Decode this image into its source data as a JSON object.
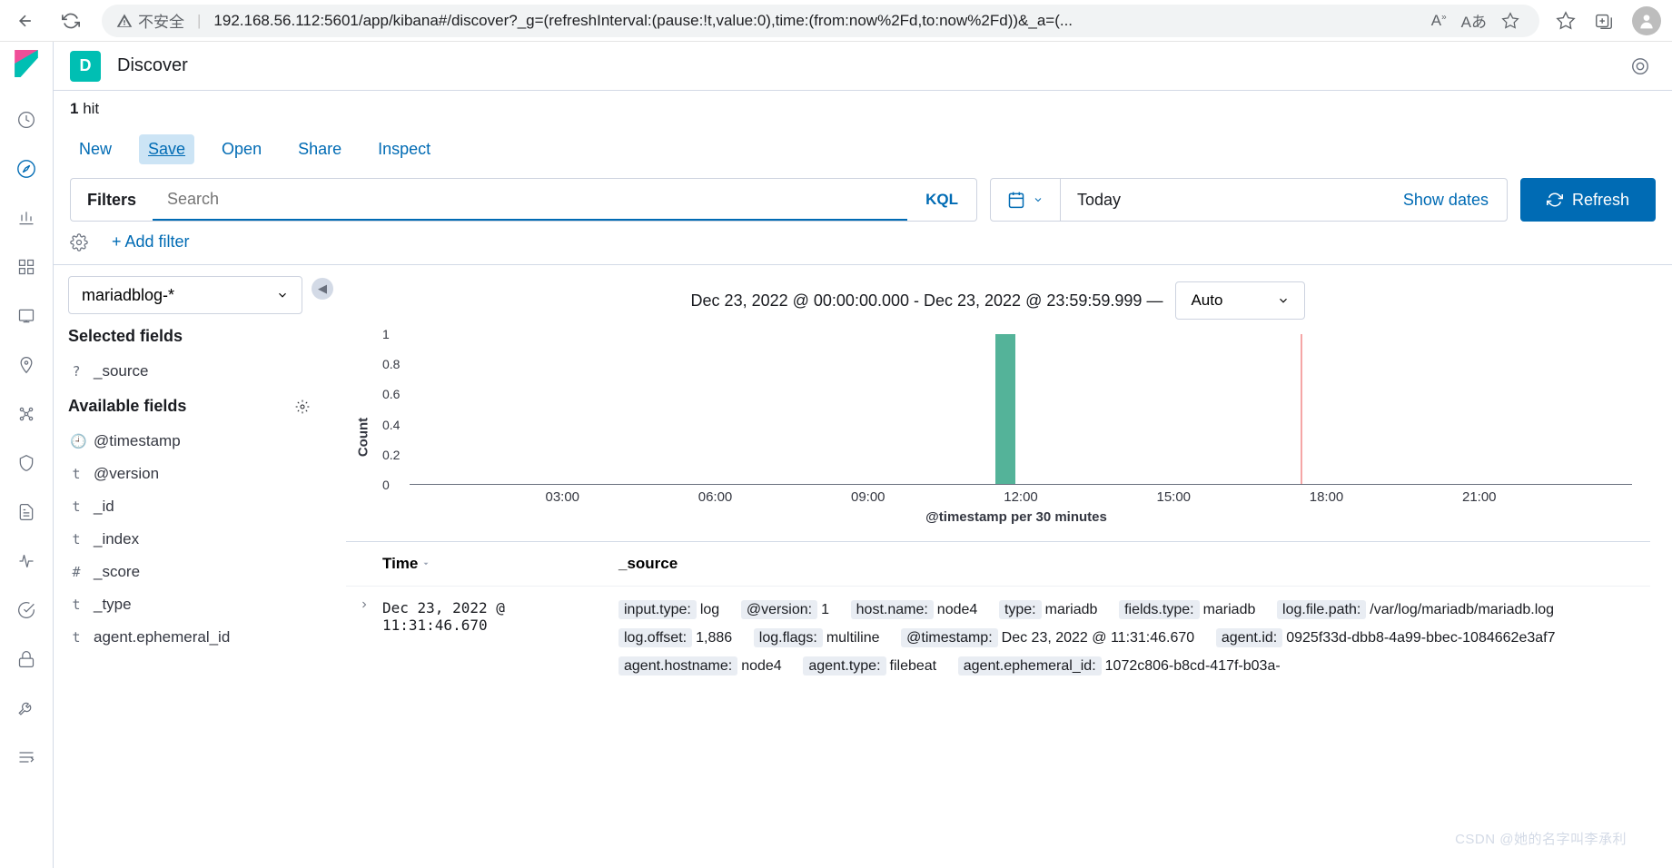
{
  "browser": {
    "unsafe_label": "不安全",
    "url": "192.168.56.112:5601/app/kibana#/discover?_g=(refreshInterval:(pause:!t,value:0),time:(from:now%2Fd,to:now%2Fd))&_a=(...",
    "reader_icon": "Aあ"
  },
  "app": {
    "badge": "D",
    "title": "Discover"
  },
  "hits": {
    "count": "1",
    "label": "hit"
  },
  "toolbar": {
    "new": "New",
    "save": "Save",
    "open": "Open",
    "share": "Share",
    "inspect": "Inspect"
  },
  "query": {
    "filters_label": "Filters",
    "placeholder": "Search",
    "kql": "KQL"
  },
  "datepicker": {
    "label": "Today",
    "show_dates": "Show dates"
  },
  "refresh": "Refresh",
  "filter_bar": {
    "add_filter": "+ Add filter"
  },
  "index_pattern": "mariadblog-*",
  "selected_fields_label": "Selected fields",
  "available_fields_label": "Available fields",
  "selected_fields": [
    {
      "type": "?",
      "name": "_source"
    }
  ],
  "available_fields": [
    {
      "type": "🕘",
      "name": "@timestamp"
    },
    {
      "type": "t",
      "name": "@version"
    },
    {
      "type": "t",
      "name": "_id"
    },
    {
      "type": "t",
      "name": "_index"
    },
    {
      "type": "#",
      "name": "_score"
    },
    {
      "type": "t",
      "name": "_type"
    },
    {
      "type": "t",
      "name": "agent.ephemeral_id"
    }
  ],
  "range_text": "Dec 23, 2022 @ 00:00:00.000 - Dec 23, 2022 @ 23:59:59.999 —",
  "interval": "Auto",
  "chart": {
    "ylabel": "Count",
    "xlabel": "@timestamp per 30 minutes"
  },
  "chart_data": {
    "type": "bar",
    "title": "",
    "xlabel": "@timestamp per 30 minutes",
    "ylabel": "Count",
    "ylim": [
      0,
      1
    ],
    "yticks": [
      0,
      0.2,
      0.4,
      0.6,
      0.8,
      1
    ],
    "xticks": [
      "03:00",
      "06:00",
      "09:00",
      "12:00",
      "15:00",
      "18:00",
      "21:00"
    ],
    "bars": [
      {
        "time": "11:30",
        "count": 1
      }
    ],
    "now_marker": "17:30"
  },
  "table": {
    "col_time": "Time",
    "col_source": "_source",
    "rows": [
      {
        "time": "Dec 23, 2022 @ 11:31:46.670",
        "kv": [
          {
            "k": "input.type:",
            "v": "log"
          },
          {
            "k": "@version:",
            "v": "1"
          },
          {
            "k": "host.name:",
            "v": "node4"
          },
          {
            "k": "type:",
            "v": "mariadb"
          },
          {
            "k": "fields.type:",
            "v": "mariadb"
          },
          {
            "k": "log.file.path:",
            "v": "/var/log/mariadb/mariadb.log"
          },
          {
            "k": "log.offset:",
            "v": "1,886"
          },
          {
            "k": "log.flags:",
            "v": "multiline"
          },
          {
            "k": "@timestamp:",
            "v": "Dec 23, 2022 @ 11:31:46.670"
          },
          {
            "k": "agent.id:",
            "v": "0925f33d-dbb8-4a99-bbec-1084662e3af7"
          },
          {
            "k": "agent.hostname:",
            "v": "node4"
          },
          {
            "k": "agent.type:",
            "v": "filebeat"
          },
          {
            "k": "agent.ephemeral_id:",
            "v": "1072c806-b8cd-417f-b03a-"
          }
        ]
      }
    ]
  },
  "watermark": "CSDN @她的名字叫李承利"
}
